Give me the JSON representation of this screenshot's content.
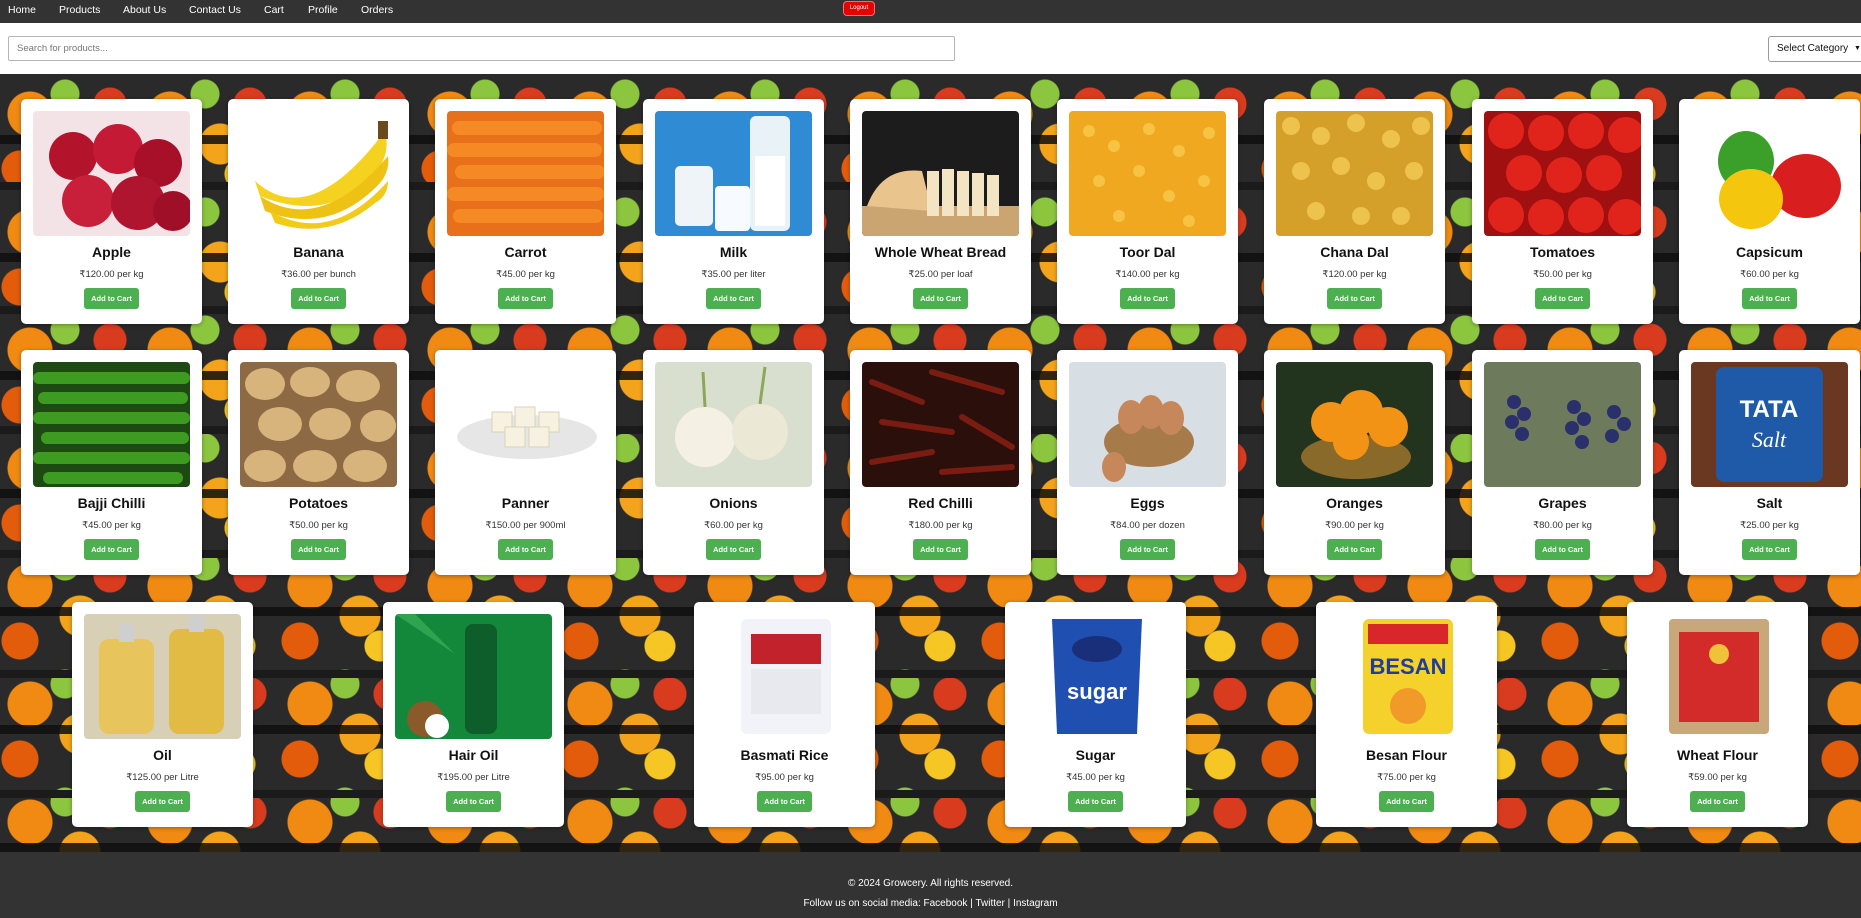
{
  "nav": {
    "home": "Home",
    "products": "Products",
    "about": "About Us",
    "contact": "Contact Us",
    "cart": "Cart",
    "profile": "Profile",
    "orders": "Orders",
    "logout": "Logout"
  },
  "search": {
    "placeholder": "Search for products...",
    "category_label": "Select Category"
  },
  "add_to_cart_label": "Add to Cart",
  "products": [
    {
      "name": "Apple",
      "price": "₹120.00 per kg",
      "icon": "apple-image"
    },
    {
      "name": "Banana",
      "price": "₹36.00 per bunch",
      "icon": "banana-image"
    },
    {
      "name": "Carrot",
      "price": "₹45.00 per kg",
      "icon": "carrot-image"
    },
    {
      "name": "Milk",
      "price": "₹35.00 per liter",
      "icon": "milk-image"
    },
    {
      "name": "Whole Wheat Bread",
      "price": "₹25.00 per loaf",
      "icon": "bread-image"
    },
    {
      "name": "Toor Dal",
      "price": "₹140.00 per kg",
      "icon": "toor-dal-image"
    },
    {
      "name": "Chana Dal",
      "price": "₹120.00 per kg",
      "icon": "chana-dal-image"
    },
    {
      "name": "Tomatoes",
      "price": "₹50.00 per kg",
      "icon": "tomatoes-image"
    },
    {
      "name": "Capsicum",
      "price": "₹60.00 per kg",
      "icon": "capsicum-image"
    },
    {
      "name": "Bajji Chilli",
      "price": "₹45.00 per kg",
      "icon": "bajji-chilli-image"
    },
    {
      "name": "Potatoes",
      "price": "₹50.00 per kg",
      "icon": "potatoes-image"
    },
    {
      "name": "Panner",
      "price": "₹150.00 per 900ml",
      "icon": "paneer-image"
    },
    {
      "name": "Onions",
      "price": "₹60.00 per kg",
      "icon": "onions-image"
    },
    {
      "name": "Red Chilli",
      "price": "₹180.00 per kg",
      "icon": "red-chilli-image"
    },
    {
      "name": "Eggs",
      "price": "₹84.00 per dozen",
      "icon": "eggs-image"
    },
    {
      "name": "Oranges",
      "price": "₹90.00 per kg",
      "icon": "oranges-image"
    },
    {
      "name": "Grapes",
      "price": "₹80.00 per kg",
      "icon": "grapes-image"
    },
    {
      "name": "Salt",
      "price": "₹25.00 per kg",
      "icon": "salt-image"
    },
    {
      "name": "Oil",
      "price": "₹125.00 per Litre",
      "icon": "oil-image"
    },
    {
      "name": "Hair Oil",
      "price": "₹195.00 per Litre",
      "icon": "hair-oil-image"
    },
    {
      "name": "Basmati Rice",
      "price": "₹95.00 per kg",
      "icon": "basmati-rice-image"
    },
    {
      "name": "Sugar",
      "price": "₹45.00 per kg",
      "icon": "sugar-image"
    },
    {
      "name": "Besan Flour",
      "price": "₹75.00 per kg",
      "icon": "besan-flour-image"
    },
    {
      "name": "Wheat Flour",
      "price": "₹59.00 per kg",
      "icon": "wheat-flour-image"
    }
  ],
  "footer": {
    "copyright": "© 2024 Growcery. All rights reserved.",
    "follow": "Follow us on social media:",
    "facebook": "Facebook",
    "twitter": "Twitter",
    "instagram": "Instagram",
    "sep": "|"
  },
  "colors": {
    "nav_bg": "#333333",
    "button_green": "#4caf50",
    "logout_red": "#e60000"
  }
}
